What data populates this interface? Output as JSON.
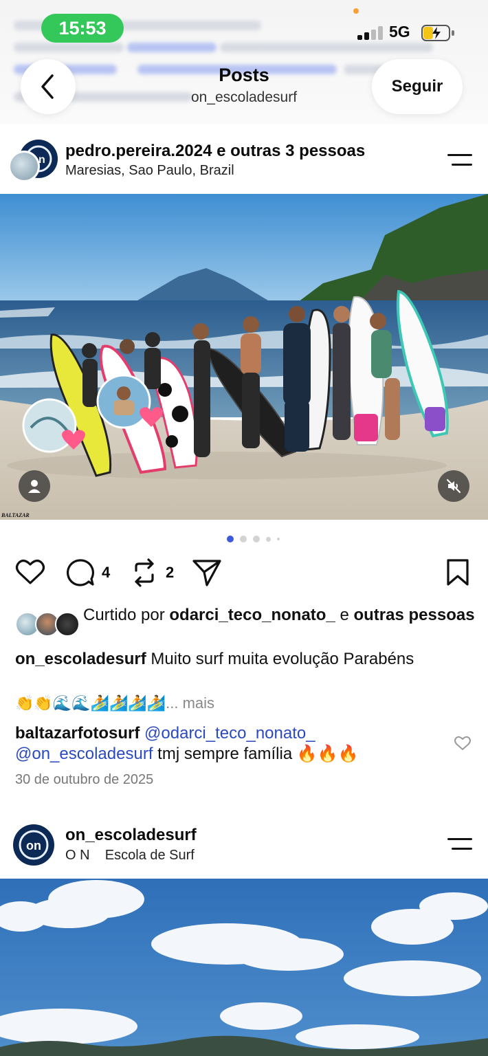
{
  "status_bar": {
    "time": "15:53",
    "network": "5G"
  },
  "header": {
    "title": "Posts",
    "subtitle": "on_escoladesurf",
    "follow_label": "Seguir"
  },
  "post1": {
    "username": "pedro.pereira.2024 e outras 3 pessoas",
    "location": "Maresias, Sao Paulo, Brazil",
    "photo_credit": "BALTAZAR",
    "comments_count": "4",
    "reposts_count": "2",
    "liked_by_prefix": "Curtido por ",
    "liked_by_user": "odarci_teco_nonato_",
    "liked_by_mid": " e ",
    "liked_by_suffix": "outras pessoas",
    "caption_user": "on_escoladesurf",
    "caption_text": " Muito surf muita evolução Parabéns",
    "caption_emojis": "👏👏🌊🌊🏄🏄🏄🏄",
    "more_label": "... mais",
    "comment_user": "baltazarfotosurf",
    "comment_mention1": "@odarci_teco_nonato_",
    "comment_mention2": "@on_escoladesurf",
    "comment_text": "  tmj sempre família 🔥🔥🔥",
    "date": "30 de outubro de 2025"
  },
  "post2": {
    "username": "on_escoladesurf",
    "subtitle": "O N    Escola de Surf"
  },
  "colors": {
    "status_pill": "#34c759",
    "mention": "#2b4ac0",
    "carousel_active": "#3b5bdb"
  },
  "icons": [
    "back-icon",
    "menu-icon",
    "heart-icon",
    "comment-icon",
    "repost-icon",
    "share-icon",
    "bookmark-icon",
    "person-icon",
    "mute-icon"
  ]
}
